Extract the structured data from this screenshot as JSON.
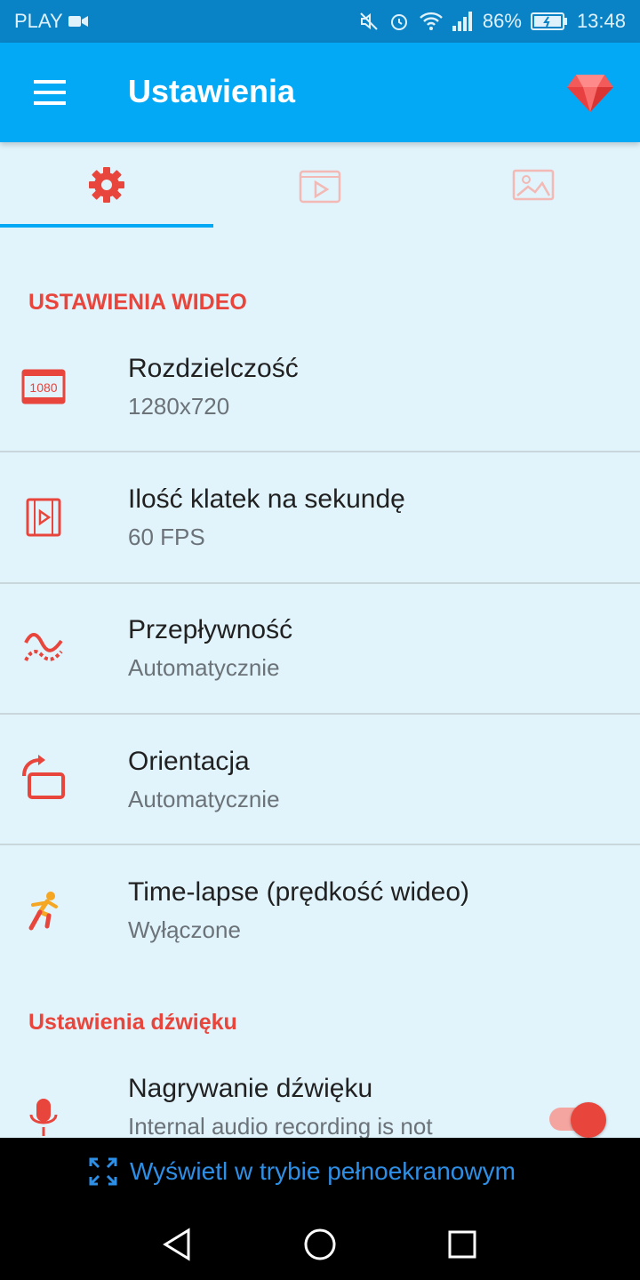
{
  "status_bar": {
    "carrier": "PLAY",
    "battery": "86%",
    "time": "13:48"
  },
  "app_bar": {
    "title": "Ustawienia",
    "menu_icon": "menu-icon",
    "premium_icon": "gem-icon"
  },
  "tabs": [
    {
      "icon": "gear-icon",
      "active": true
    },
    {
      "icon": "video-icon",
      "active": false
    },
    {
      "icon": "image-icon",
      "active": false
    }
  ],
  "video_section": {
    "header": "USTAWIENIA WIDEO",
    "items": [
      {
        "icon": "resolution-1080-icon",
        "icon_text": "1080",
        "title": "Rozdzielczość",
        "value": "1280x720"
      },
      {
        "icon": "film-frame-icon",
        "title": "Ilość klatek na sekundę",
        "value": "60 FPS"
      },
      {
        "icon": "bitrate-wave-icon",
        "title": "Przepływność",
        "value": "Automatycznie"
      },
      {
        "icon": "rotate-screen-icon",
        "title": "Orientacja",
        "value": "Automatycznie"
      },
      {
        "icon": "running-person-icon",
        "title": "Time-lapse (prędkość wideo)",
        "value": "Wyłączone"
      }
    ]
  },
  "audio_section": {
    "header": "Ustawienia dźwięku",
    "items": [
      {
        "icon": "microphone-icon",
        "title": "Nagrywanie dźwięku",
        "value": "Internal audio recording is not",
        "toggle_on": true
      }
    ]
  },
  "bottom_bar": {
    "fullscreen_label": "Wyświetl w trybie pełnoekranowym"
  },
  "colors": {
    "app_bar": "#03a9f4",
    "status_bar": "#0a83c6",
    "accent_red": "#e8453c",
    "background": "#e1f3fb"
  }
}
